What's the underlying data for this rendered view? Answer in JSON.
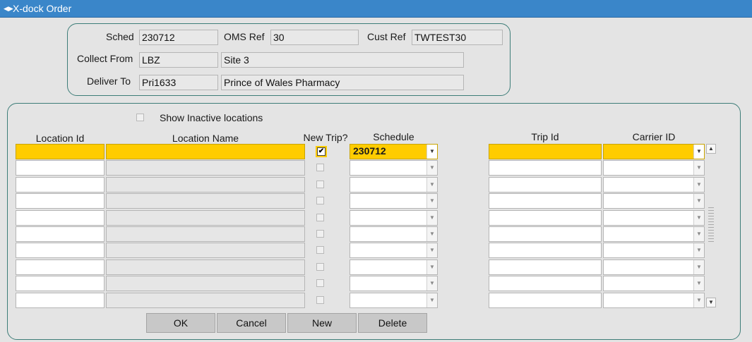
{
  "window": {
    "title": "X-dock Order",
    "icon": "window-menu-icon"
  },
  "header": {
    "sched_label": "Sched",
    "sched_value": "230712",
    "oms_ref_label": "OMS Ref",
    "oms_ref_value": "30",
    "cust_ref_label": "Cust Ref",
    "cust_ref_value": "TWTEST30",
    "collect_from_label": "Collect From",
    "collect_from_code": "LBZ",
    "collect_from_name": "Site 3",
    "deliver_to_label": "Deliver To",
    "deliver_to_code": "Pri1633",
    "deliver_to_name": "Prince of Wales Pharmacy"
  },
  "grid": {
    "show_inactive_label": "Show Inactive locations",
    "show_inactive_checked": false,
    "columns": {
      "location_id": "Location Id",
      "location_name": "Location Name",
      "new_trip": "New Trip?",
      "schedule": "Schedule",
      "trip_id": "Trip Id",
      "carrier_id": "Carrier ID"
    },
    "rows": [
      {
        "location_id": "",
        "location_name": "",
        "new_trip": true,
        "schedule": "230712",
        "trip_id": "",
        "carrier_id": ""
      },
      {
        "location_id": "",
        "location_name": "",
        "new_trip": false,
        "schedule": "",
        "trip_id": "",
        "carrier_id": ""
      },
      {
        "location_id": "",
        "location_name": "",
        "new_trip": false,
        "schedule": "",
        "trip_id": "",
        "carrier_id": ""
      },
      {
        "location_id": "",
        "location_name": "",
        "new_trip": false,
        "schedule": "",
        "trip_id": "",
        "carrier_id": ""
      },
      {
        "location_id": "",
        "location_name": "",
        "new_trip": false,
        "schedule": "",
        "trip_id": "",
        "carrier_id": ""
      },
      {
        "location_id": "",
        "location_name": "",
        "new_trip": false,
        "schedule": "",
        "trip_id": "",
        "carrier_id": ""
      },
      {
        "location_id": "",
        "location_name": "",
        "new_trip": false,
        "schedule": "",
        "trip_id": "",
        "carrier_id": ""
      },
      {
        "location_id": "",
        "location_name": "",
        "new_trip": false,
        "schedule": "",
        "trip_id": "",
        "carrier_id": ""
      },
      {
        "location_id": "",
        "location_name": "",
        "new_trip": false,
        "schedule": "",
        "trip_id": "",
        "carrier_id": ""
      },
      {
        "location_id": "",
        "location_name": "",
        "new_trip": false,
        "schedule": "",
        "trip_id": "",
        "carrier_id": ""
      }
    ]
  },
  "buttons": {
    "ok": "OK",
    "cancel": "Cancel",
    "new": "New",
    "delete": "Delete"
  },
  "colors": {
    "titlebar": "#3a86c9",
    "selection": "#ffcc00",
    "group_border": "#3d7d78",
    "background": "#e4e4e4"
  }
}
